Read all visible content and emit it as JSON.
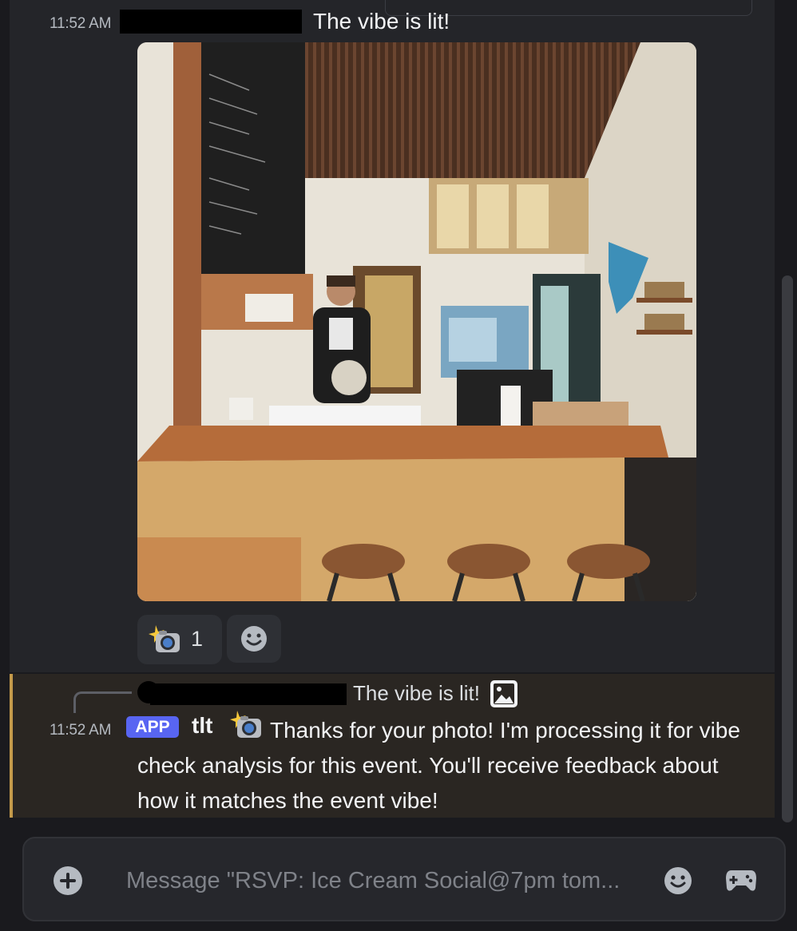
{
  "message": {
    "timestamp": "11:52 AM",
    "text": "The vibe is lit!",
    "image": "coffee-shop-barista-photo",
    "reaction": {
      "icon": "camera-flash-icon",
      "count": "1"
    },
    "add_reaction_icon": "add-reaction-smiley-icon"
  },
  "bot_reply": {
    "reply_preview_text": "The vibe is lit!",
    "reply_image_icon": "image-icon",
    "timestamp": "11:52 AM",
    "badge": "APP",
    "username": "tlt",
    "emoji": "camera-flash-icon",
    "text": "Thanks for your photo! I'm processing it for vibe check analysis for this event. You'll receive feedback about how it matches the event vibe!",
    "accent_color": "#c49a4a"
  },
  "composer": {
    "placeholder": "Message \"RSVP: Ice Cream Social@7pm tom...",
    "plus_icon": "plus-circle-icon",
    "emoji_icon": "smiley-icon",
    "game_icon": "gamepad-icon"
  },
  "colors": {
    "background": "#1a1a1e",
    "highlight": "#242529",
    "app_badge": "#5865f2"
  }
}
